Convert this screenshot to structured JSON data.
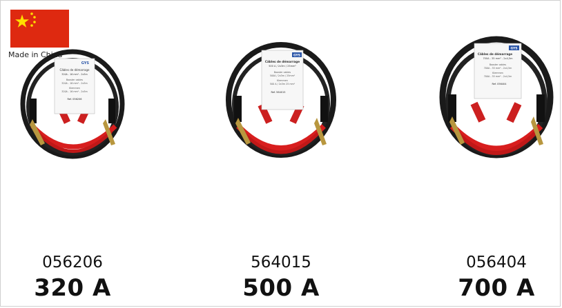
{
  "origin": {
    "label": "Made in China",
    "flag_icon": "china-flag-icon",
    "flag_color": "#de2910",
    "star_color": "#ffde00"
  },
  "products": [
    {
      "ref": "056206",
      "amperage": "320 A",
      "tag": {
        "brand": "GYS",
        "title": "Câbles de démarrage",
        "line1": "320A - 16 mm² - 2x3m",
        "line2": "Booster cables",
        "line3": "320A - 16 mm² - 2x3m",
        "line4": "Klemmen",
        "line5": "320A - 16 mm² - 2x3m",
        "ref_label": "Ref. 056206"
      }
    },
    {
      "ref": "564015",
      "amperage": "500 A",
      "tag": {
        "brand": "GYS",
        "title": "Câbles de démarrage",
        "line1": "500 A / 2x3m / 25mm²",
        "line2": "Booster cables",
        "line3": "500A / 2x3m / 25mm²",
        "line4": "Klemmen",
        "line5": "500 A / 2x3m 25 mm²",
        "ref_label": "Ref. 564015"
      }
    },
    {
      "ref": "056404",
      "amperage": "700 A",
      "tag": {
        "brand": "GYS",
        "title": "Câbles de démarrage",
        "line1": "700A - 35 mm² - 2x4,5m",
        "line2": "Booster cables",
        "line3": "700A - 35 mm² - 2x4,5m",
        "line4": "Klemmen",
        "line5": "700A - 35 mm² - 2x4,5m",
        "ref_label": "Ref. 056404"
      }
    }
  ]
}
